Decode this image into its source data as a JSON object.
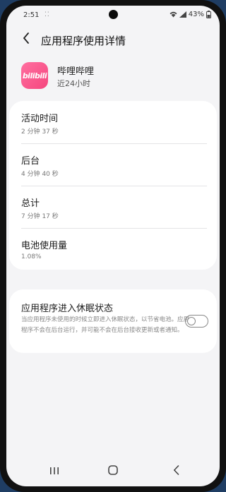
{
  "statusbar": {
    "time": "2:51",
    "notif": "⁚⁚",
    "battery": "43%"
  },
  "header": {
    "title": "应用程序使用详情"
  },
  "app": {
    "icon_text": "bilibili",
    "name": "哔哩哔哩",
    "subtitle": "近24小时"
  },
  "usage": {
    "rows": [
      {
        "label": "活动时间",
        "value": "2 分钟 37 秒"
      },
      {
        "label": "后台",
        "value": "4 分钟 40 秒"
      },
      {
        "label": "总计",
        "value": "7 分钟 17 秒"
      },
      {
        "label": "电池使用量",
        "value": "1.08%"
      }
    ]
  },
  "sleep": {
    "title": "应用程序进入休眠状态",
    "description": "当应用程序未使用的时候立即进入休眠状态，以节省电池。应用程序不会在后台运行，并可能不会在后台接收更新或者通知。",
    "enabled": false
  },
  "icons": {
    "back": "chevron-left-icon",
    "wifi": "wifi-icon",
    "signal": "signal-icon",
    "battery": "battery-icon",
    "nav_recent": "recent-apps-icon",
    "nav_home": "home-icon",
    "nav_back": "back-icon"
  },
  "colors": {
    "app_icon": "#f5467e",
    "screen_bg": "#f4f4f6",
    "card_bg": "#ffffff"
  }
}
